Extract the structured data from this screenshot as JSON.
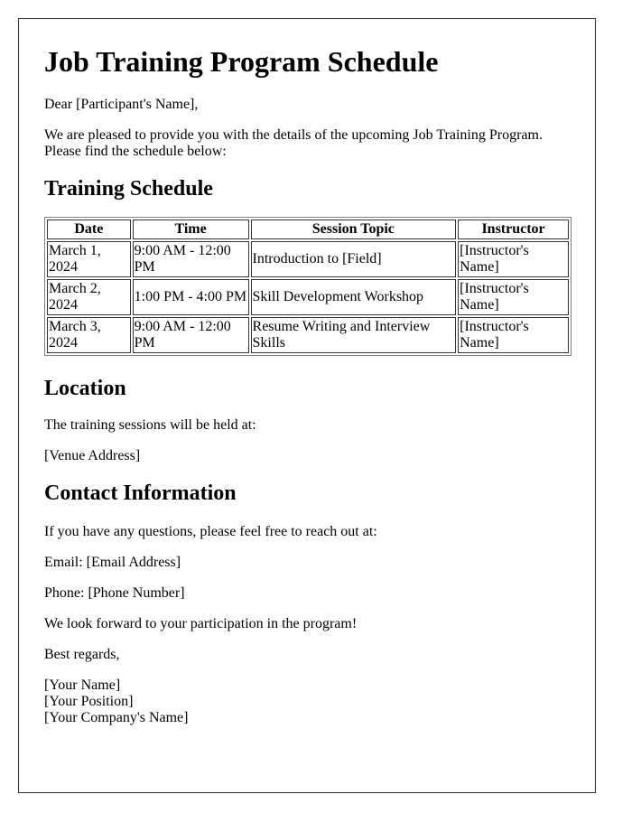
{
  "title": "Job Training Program Schedule",
  "greeting": "Dear [Participant's Name],",
  "intro": "We are pleased to provide you with the details of the upcoming Job Training Program. Please find the schedule below:",
  "schedule": {
    "heading": "Training Schedule",
    "columns": [
      "Date",
      "Time",
      "Session Topic",
      "Instructor"
    ],
    "rows": [
      {
        "date": "March 1, 2024",
        "time": "9:00 AM - 12:00 PM",
        "topic": "Introduction to [Field]",
        "instructor": "[Instructor's Name]"
      },
      {
        "date": "March 2, 2024",
        "time": "1:00 PM - 4:00 PM",
        "topic": "Skill Development Workshop",
        "instructor": "[Instructor's Name]"
      },
      {
        "date": "March 3, 2024",
        "time": "9:00 AM - 12:00 PM",
        "topic": "Resume Writing and Interview Skills",
        "instructor": "[Instructor's Name]"
      }
    ]
  },
  "location": {
    "heading": "Location",
    "text": "The training sessions will be held at:",
    "address": "[Venue Address]"
  },
  "contact": {
    "heading": "Contact Information",
    "text": "If you have any questions, please feel free to reach out at:",
    "email": "Email: [Email Address]",
    "phone": "Phone: [Phone Number]"
  },
  "closing": "We look forward to your participation in the program!",
  "regards": "Best regards,",
  "signature": {
    "name": "[Your Name]",
    "position": "[Your Position]",
    "company": "[Your Company's Name]"
  }
}
